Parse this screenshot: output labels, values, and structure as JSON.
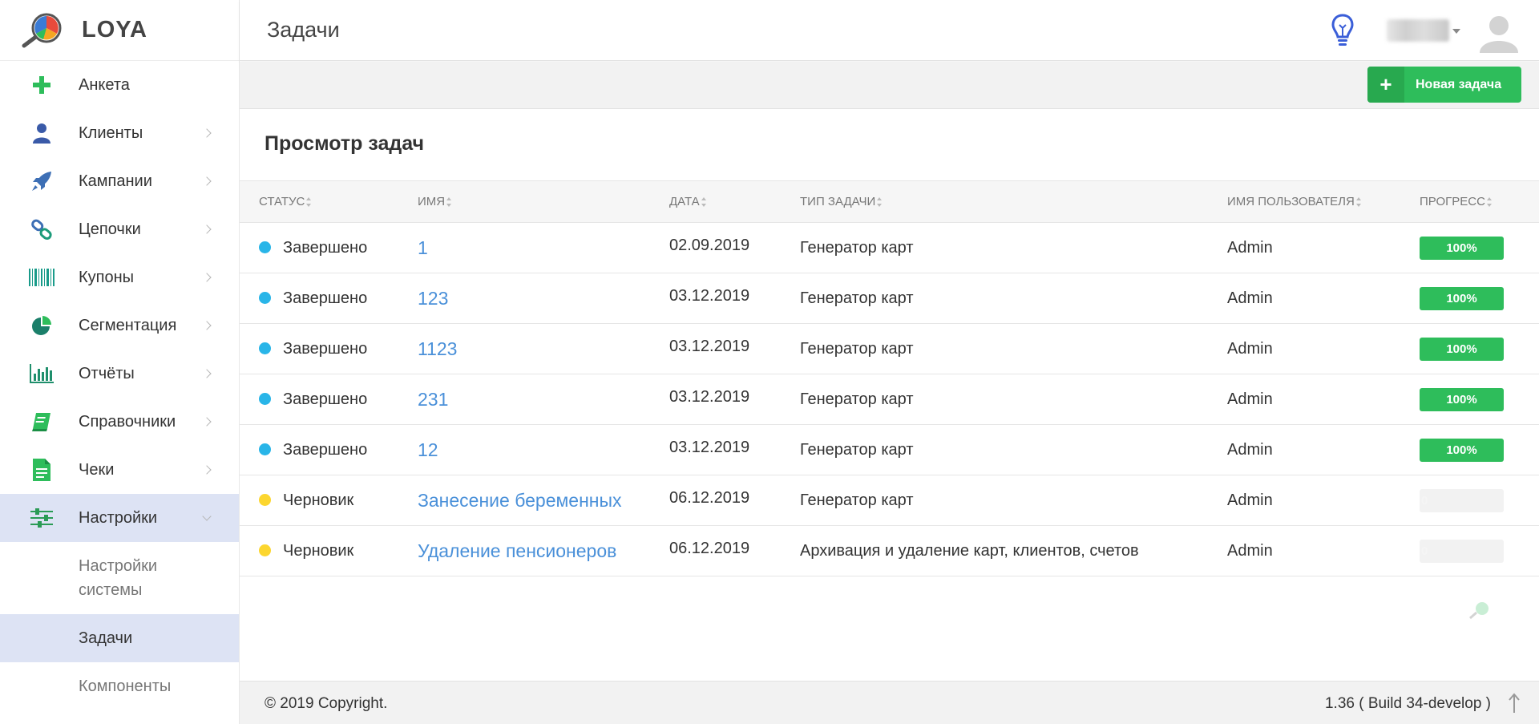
{
  "app": {
    "name": "LOYA"
  },
  "header": {
    "title": "Задачи"
  },
  "sidebar": {
    "items": [
      {
        "label": "Анкета",
        "icon": "plus-icon",
        "color": "#2ebd5b",
        "chevron": false
      },
      {
        "label": "Клиенты",
        "icon": "user-icon",
        "color": "#3a5aa8",
        "chevron": true
      },
      {
        "label": "Кампании",
        "icon": "rocket-icon",
        "color": "#3d6fb5",
        "chevron": true
      },
      {
        "label": "Цепочки",
        "icon": "link-icon",
        "color": "#3d6fb5",
        "chevron": true
      },
      {
        "label": "Купоны",
        "icon": "barcode-icon",
        "color": "#1a9b8a",
        "chevron": true
      },
      {
        "label": "Сегментация",
        "icon": "pie-chart-icon",
        "color": "#1b7f6a",
        "chevron": true
      },
      {
        "label": "Отчёты",
        "icon": "bar-chart-icon",
        "color": "#1f8f6c",
        "chevron": true
      },
      {
        "label": "Справочники",
        "icon": "book-icon",
        "color": "#2ebd5b",
        "chevron": true
      },
      {
        "label": "Чеки",
        "icon": "document-icon",
        "color": "#2ebd5b",
        "chevron": true
      },
      {
        "label": "Настройки",
        "icon": "sliders-icon",
        "color": "#2a9b55",
        "chevron": true
      }
    ],
    "subitems": [
      {
        "label": "Настройки системы"
      },
      {
        "label": "Задачи"
      },
      {
        "label": "Компоненты"
      }
    ]
  },
  "toolbar": {
    "new_task_label": "Новая задача"
  },
  "main": {
    "section_title": "Просмотр задач",
    "columns": [
      "Статус",
      "Имя",
      "Дата",
      "Тип задачи",
      "Имя пользователя",
      "Прогресс"
    ],
    "rows": [
      {
        "status": "Завершено",
        "status_type": "done",
        "name": "1",
        "date": "02.09.2019",
        "type": "Генератор карт",
        "user": "Admin",
        "progress": 100,
        "progress_label": "100%"
      },
      {
        "status": "Завершено",
        "status_type": "done",
        "name": "123",
        "date": "03.12.2019",
        "type": "Генератор карт",
        "user": "Admin",
        "progress": 100,
        "progress_label": "100%"
      },
      {
        "status": "Завершено",
        "status_type": "done",
        "name": "1123",
        "date": "03.12.2019",
        "type": "Генератор карт",
        "user": "Admin",
        "progress": 100,
        "progress_label": "100%"
      },
      {
        "status": "Завершено",
        "status_type": "done",
        "name": "231",
        "date": "03.12.2019",
        "type": "Генератор карт",
        "user": "Admin",
        "progress": 100,
        "progress_label": "100%"
      },
      {
        "status": "Завершено",
        "status_type": "done",
        "name": "12",
        "date": "03.12.2019",
        "type": "Генератор карт",
        "user": "Admin",
        "progress": 100,
        "progress_label": "100%"
      },
      {
        "status": "Черновик",
        "status_type": "draft",
        "name": "Занесение беременных",
        "date": "06.12.2019",
        "type": "Генератор карт",
        "user": "Admin",
        "progress": 0,
        "progress_label": "0"
      },
      {
        "status": "Черновик",
        "status_type": "draft",
        "name": "Удаление пенсионеров",
        "date": "06.12.2019",
        "type": "Архивация и удаление карт, клиентов, счетов",
        "user": "Admin",
        "progress": 0,
        "progress_label": "0"
      }
    ]
  },
  "footer": {
    "copyright": "© 2019 Copyright.",
    "version": "1.36 ( Build 34-develop )"
  },
  "colors": {
    "accent_green": "#2ebd5b",
    "status_done": "#29b5e8",
    "status_draft": "#fcd62f",
    "link": "#4a90d9",
    "active_bg": "#dde3f4"
  }
}
